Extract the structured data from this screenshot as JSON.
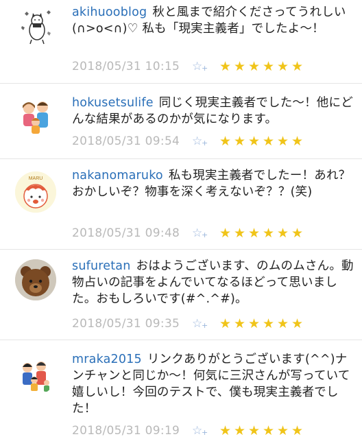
{
  "comments": [
    {
      "user": "akihuooblog",
      "text": "秋と風まで紹介くださってうれしい(∩>o<∩)♡ 私も「現実主義者」でしたよ〜！",
      "date": "2018/05/31 10:15",
      "add_star_icon": "star-add-icon",
      "stars": [
        "★",
        "★",
        "★",
        "★",
        "★",
        "★"
      ]
    },
    {
      "user": "hokusetsulife",
      "text": "同じく現実主義者でした〜！他にどんな結果があるのかが気になります。",
      "date": "2018/05/31 09:54",
      "add_star_icon": "star-add-icon",
      "stars": [
        "★",
        "★",
        "★",
        "★",
        "★",
        "★"
      ]
    },
    {
      "user": "nakanomaruko",
      "text": "私も現実主義者でしたー！あれ？おかしいぞ？物事を深く考えないぞ？？(笑)",
      "date": "2018/05/31 09:48",
      "add_star_icon": "star-add-icon",
      "stars": [
        "★",
        "★",
        "★",
        "★",
        "★",
        "★"
      ]
    },
    {
      "user": "sufuretan",
      "text": "おはようございます、のムのムさん。動物占いの記事をよんでいてなるほどって思いました。おもしろいです(#^.^#)。",
      "date": "2018/05/31 09:35",
      "add_star_icon": "star-add-icon",
      "stars": [
        "★",
        "★",
        "★",
        "★",
        "★",
        "★"
      ]
    },
    {
      "user": "mraka2015",
      "text": "リンクありがとうございます(^^)ナンチャンと同じか〜！何気に三沢さんが写っていて嬉しいし！今回のテストで、僕も現実主義者でした！",
      "date": "2018/05/31 09:19",
      "add_star_icon": "star-add-icon",
      "stars": [
        "★",
        "★",
        "★",
        "★",
        "★",
        "★"
      ]
    }
  ],
  "avatars": {
    "0": {
      "label": ""
    },
    "2": {
      "label": "MARU"
    }
  },
  "colors": {
    "username": "#2a6fb8",
    "text": "#222222",
    "date": "#b9b9b9",
    "star": "#f0c419",
    "add_star": "#9bb6dc",
    "divider": "#e4e4e4"
  }
}
